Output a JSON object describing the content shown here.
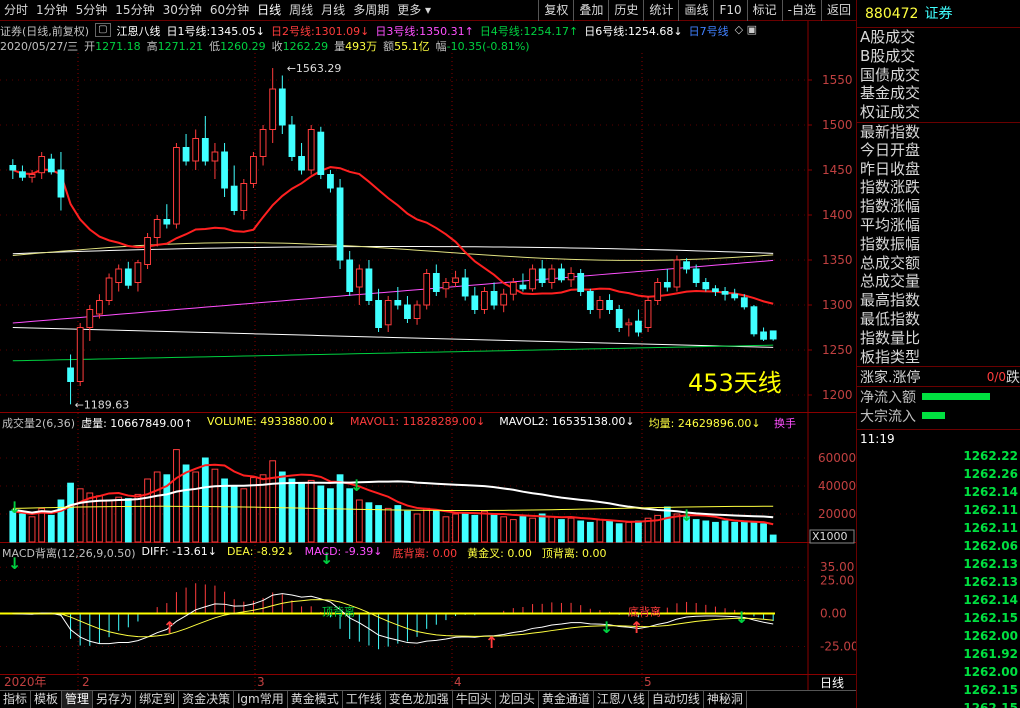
{
  "toolbar": {
    "items": [
      "分时",
      "1分钟",
      "5分钟",
      "15分钟",
      "30分钟",
      "60分钟",
      "日线",
      "周线",
      "月线",
      "多周期",
      "更多"
    ],
    "active": "日线",
    "right_items": [
      "复权",
      "叠加",
      "历史",
      "统计",
      "画线",
      "F10",
      "标记",
      "-自选",
      "返回"
    ]
  },
  "info": {
    "title": "证券(日线,前复权)",
    "indicator": "江恩八线",
    "lines": [
      {
        "label": "日1号线:",
        "value": "1345.05",
        "arrow": "↓",
        "color": "#ffffff"
      },
      {
        "label": "日2号线:",
        "value": "1301.09",
        "arrow": "↓",
        "color": "#ff3c3c"
      },
      {
        "label": "日3号线:",
        "value": "1350.31",
        "arrow": "↑",
        "color": "#ff50ff"
      },
      {
        "label": "日4号线:",
        "value": "1254.17",
        "arrow": "↑",
        "color": "#00d040"
      },
      {
        "label": "日6号线:",
        "value": "1254.68",
        "arrow": "↓",
        "color": "#ffffff"
      },
      {
        "label": "日7号线",
        "value": "",
        "arrow": "",
        "color": "#4080ff"
      }
    ],
    "date_line": {
      "date": "2020/05/27/三",
      "open_label": "开",
      "open": "1271.18",
      "high_label": "高",
      "high": "1271.21",
      "low_label": "低",
      "low": "1260.29",
      "close_label": "收",
      "close": "1262.29",
      "vol_label": "量",
      "vol": "493万",
      "amt_label": "额",
      "amt": "55.1亿",
      "chg_label": "幅",
      "chg": "-10.35(-0.81%)"
    }
  },
  "price_axis": [
    "1550",
    "1500",
    "1450",
    "1400",
    "1350",
    "1300",
    "1250",
    "1200"
  ],
  "price_annotations": {
    "high": "1563.29",
    "low": "1189.63"
  },
  "overlay_text": "453天线",
  "volume_info": {
    "name": "成交量2(6,36)",
    "items": [
      {
        "label": "虚量:",
        "value": "10667849.00",
        "arrow": "↑",
        "color": "#ffffff"
      },
      {
        "label": "VOLUME:",
        "value": "4933880.00",
        "arrow": "↓",
        "color": "#ffff40"
      },
      {
        "label": "MAVOL1:",
        "value": "11828289.00",
        "arrow": "↓",
        "color": "#ff3c3c"
      },
      {
        "label": "MAVOL2:",
        "value": "16535138.00",
        "arrow": "↓",
        "color": "#ffffff"
      },
      {
        "label": "均量:",
        "value": "24629896.00",
        "arrow": "↓",
        "color": "#ffff40"
      }
    ],
    "switch": "换手"
  },
  "volume_axis": [
    "60000",
    "40000",
    "20000"
  ],
  "volume_unit": "X1000",
  "macd_info": {
    "name": "MACD背离(12,26,9,0.50)",
    "items": [
      {
        "label": "DIFF:",
        "value": "-13.61",
        "arrow": "↓",
        "color": "#ffffff"
      },
      {
        "label": "DEA:",
        "value": "-8.92",
        "arrow": "↓",
        "color": "#ffff40"
      },
      {
        "label": "MACD:",
        "value": "-9.39",
        "arrow": "↓",
        "color": "#ff50ff"
      },
      {
        "label": "底背离:",
        "value": "0.00",
        "arrow": "",
        "color": "#ff3c3c"
      },
      {
        "label": "黄金叉:",
        "value": "0.00",
        "arrow": "",
        "color": "#ffff40"
      },
      {
        "label": "顶背离:",
        "value": "0.00",
        "arrow": "",
        "color": "#ffff40"
      }
    ],
    "tags": {
      "top_div": "顶背离",
      "bottom_div": "底背离"
    }
  },
  "macd_axis": [
    "35.00",
    "25.00",
    "0.00",
    "-25.00"
  ],
  "date_axis": [
    "2020年",
    "2",
    "3",
    "4",
    "5"
  ],
  "period": "日线",
  "nav": {
    "plus": "+",
    "minus": "-"
  },
  "tabs": [
    "指标",
    "模板",
    "管理",
    "另存为",
    "绑定到",
    "资金决策",
    "lgm常用",
    "黄金模式",
    "工作线",
    "变色龙加强",
    "牛回头",
    "龙回头",
    "黄金通道",
    "江恩八线",
    "自动切线",
    "神秘洞"
  ],
  "active_tab": "管理",
  "right_panel": {
    "code": "880472",
    "name": "证券",
    "items": [
      "A股成交",
      "B股成交",
      "国债成交",
      "基金成交",
      "权证成交",
      "最新指数",
      "今日开盘",
      "昨日收盘",
      "指数涨跌",
      "指数涨幅",
      "平均涨幅",
      "指数振幅",
      "总成交额",
      "总成交量",
      "最高指数",
      "最低指数",
      "指数量比",
      "板指类型"
    ],
    "updown_label": "涨家.涨停",
    "updown_value": "0/0",
    "updown_tail": "跌",
    "flows": [
      {
        "label": "净流入额",
        "fill": 0.75
      },
      {
        "label": "大宗流入",
        "fill": 0.25
      }
    ],
    "time": "11:19",
    "ticks": [
      "1262.22",
      "1262.26",
      "1262.14",
      "1262.11",
      "1262.11",
      "1262.06",
      "1262.13",
      "1262.13",
      "1262.14",
      "1262.15",
      "1262.00",
      "1261.92",
      "1262.00",
      "1262.15",
      "1262.15"
    ]
  },
  "chart_data": {
    "type": "candlestick",
    "ylim": [
      1180,
      1580
    ],
    "candles": [
      [
        1455,
        1462,
        1440,
        1450
      ],
      [
        1448,
        1455,
        1438,
        1442
      ],
      [
        1442,
        1450,
        1436,
        1445
      ],
      [
        1447,
        1470,
        1440,
        1465
      ],
      [
        1462,
        1468,
        1445,
        1448
      ],
      [
        1450,
        1470,
        1405,
        1420
      ],
      [
        1230,
        1245,
        1189.63,
        1215
      ],
      [
        1215,
        1280,
        1210,
        1275
      ],
      [
        1275,
        1300,
        1260,
        1295
      ],
      [
        1290,
        1312,
        1285,
        1305
      ],
      [
        1305,
        1335,
        1300,
        1330
      ],
      [
        1325,
        1345,
        1315,
        1340
      ],
      [
        1340,
        1348,
        1318,
        1322
      ],
      [
        1325,
        1350,
        1315,
        1347
      ],
      [
        1345,
        1380,
        1340,
        1375
      ],
      [
        1375,
        1400,
        1365,
        1395
      ],
      [
        1395,
        1412,
        1385,
        1390
      ],
      [
        1390,
        1480,
        1385,
        1475
      ],
      [
        1475,
        1490,
        1455,
        1460
      ],
      [
        1460,
        1495,
        1450,
        1485
      ],
      [
        1485,
        1510,
        1455,
        1460
      ],
      [
        1460,
        1480,
        1440,
        1470
      ],
      [
        1470,
        1480,
        1420,
        1430
      ],
      [
        1432,
        1455,
        1400,
        1405
      ],
      [
        1405,
        1440,
        1395,
        1435
      ],
      [
        1435,
        1470,
        1430,
        1465
      ],
      [
        1465,
        1500,
        1455,
        1495
      ],
      [
        1495,
        1563.29,
        1480,
        1540
      ],
      [
        1540,
        1555,
        1490,
        1500
      ],
      [
        1500,
        1510,
        1460,
        1465
      ],
      [
        1465,
        1480,
        1445,
        1450
      ],
      [
        1450,
        1500,
        1445,
        1495
      ],
      [
        1492,
        1498,
        1440,
        1445
      ],
      [
        1445,
        1450,
        1425,
        1430
      ],
      [
        1430,
        1440,
        1340,
        1350
      ],
      [
        1350,
        1360,
        1310,
        1315
      ],
      [
        1320,
        1345,
        1300,
        1340
      ],
      [
        1340,
        1350,
        1300,
        1305
      ],
      [
        1305,
        1318,
        1270,
        1275
      ],
      [
        1278,
        1310,
        1270,
        1305
      ],
      [
        1305,
        1320,
        1295,
        1300
      ],
      [
        1300,
        1310,
        1280,
        1285
      ],
      [
        1285,
        1305,
        1278,
        1300
      ],
      [
        1300,
        1340,
        1295,
        1335
      ],
      [
        1335,
        1345,
        1310,
        1315
      ],
      [
        1318,
        1330,
        1308,
        1325
      ],
      [
        1325,
        1338,
        1320,
        1330
      ],
      [
        1330,
        1340,
        1305,
        1310
      ],
      [
        1310,
        1320,
        1290,
        1295
      ],
      [
        1295,
        1320,
        1290,
        1315
      ],
      [
        1315,
        1325,
        1295,
        1300
      ],
      [
        1300,
        1318,
        1292,
        1312
      ],
      [
        1312,
        1330,
        1305,
        1325
      ],
      [
        1322,
        1335,
        1315,
        1318
      ],
      [
        1318,
        1345,
        1315,
        1340
      ],
      [
        1340,
        1350,
        1320,
        1325
      ],
      [
        1325,
        1345,
        1318,
        1340
      ],
      [
        1340,
        1346,
        1325,
        1328
      ],
      [
        1328,
        1342,
        1320,
        1335
      ],
      [
        1335,
        1340,
        1310,
        1315
      ],
      [
        1315,
        1318,
        1290,
        1295
      ],
      [
        1295,
        1310,
        1285,
        1305
      ],
      [
        1305,
        1312,
        1290,
        1295
      ],
      [
        1295,
        1300,
        1270,
        1275
      ],
      [
        1278,
        1285,
        1265,
        1280
      ],
      [
        1282,
        1295,
        1265,
        1270
      ],
      [
        1275,
        1310,
        1270,
        1305
      ],
      [
        1305,
        1330,
        1300,
        1325
      ],
      [
        1325,
        1340,
        1315,
        1320
      ],
      [
        1320,
        1355,
        1315,
        1350
      ],
      [
        1348,
        1352,
        1335,
        1340
      ],
      [
        1340,
        1345,
        1320,
        1325
      ],
      [
        1325,
        1330,
        1315,
        1318
      ],
      [
        1318,
        1322,
        1310,
        1315
      ],
      [
        1315,
        1320,
        1305,
        1312
      ],
      [
        1312,
        1318,
        1305,
        1308
      ],
      [
        1308,
        1312,
        1295,
        1298
      ],
      [
        1298,
        1300,
        1265,
        1268
      ],
      [
        1270,
        1275,
        1260,
        1262
      ],
      [
        1271.18,
        1271.21,
        1260.29,
        1262.29
      ]
    ],
    "volume_ylim": [
      0,
      70000
    ],
    "volumes": [
      22000,
      20000,
      18000,
      24000,
      19000,
      30000,
      42000,
      38000,
      35000,
      33000,
      30000,
      32000,
      31000,
      34000,
      45000,
      50000,
      48000,
      66000,
      55000,
      50000,
      60000,
      52000,
      45000,
      40000,
      38000,
      46000,
      48000,
      58000,
      50000,
      45000,
      42000,
      44000,
      40000,
      38000,
      48000,
      38000,
      30000,
      28000,
      26000,
      24000,
      26000,
      22000,
      20000,
      24000,
      22000,
      18000,
      20000,
      21000,
      19000,
      22000,
      20000,
      18000,
      16000,
      19000,
      17000,
      20000,
      18000,
      16000,
      17000,
      15000,
      14000,
      16000,
      15000,
      13000,
      14000,
      15000,
      17000,
      19000,
      25000,
      20000,
      18000,
      16000,
      15000,
      14000,
      15000,
      14000,
      15000,
      14000,
      13000,
      4934
    ],
    "macd_ylim": [
      -45,
      45
    ]
  }
}
